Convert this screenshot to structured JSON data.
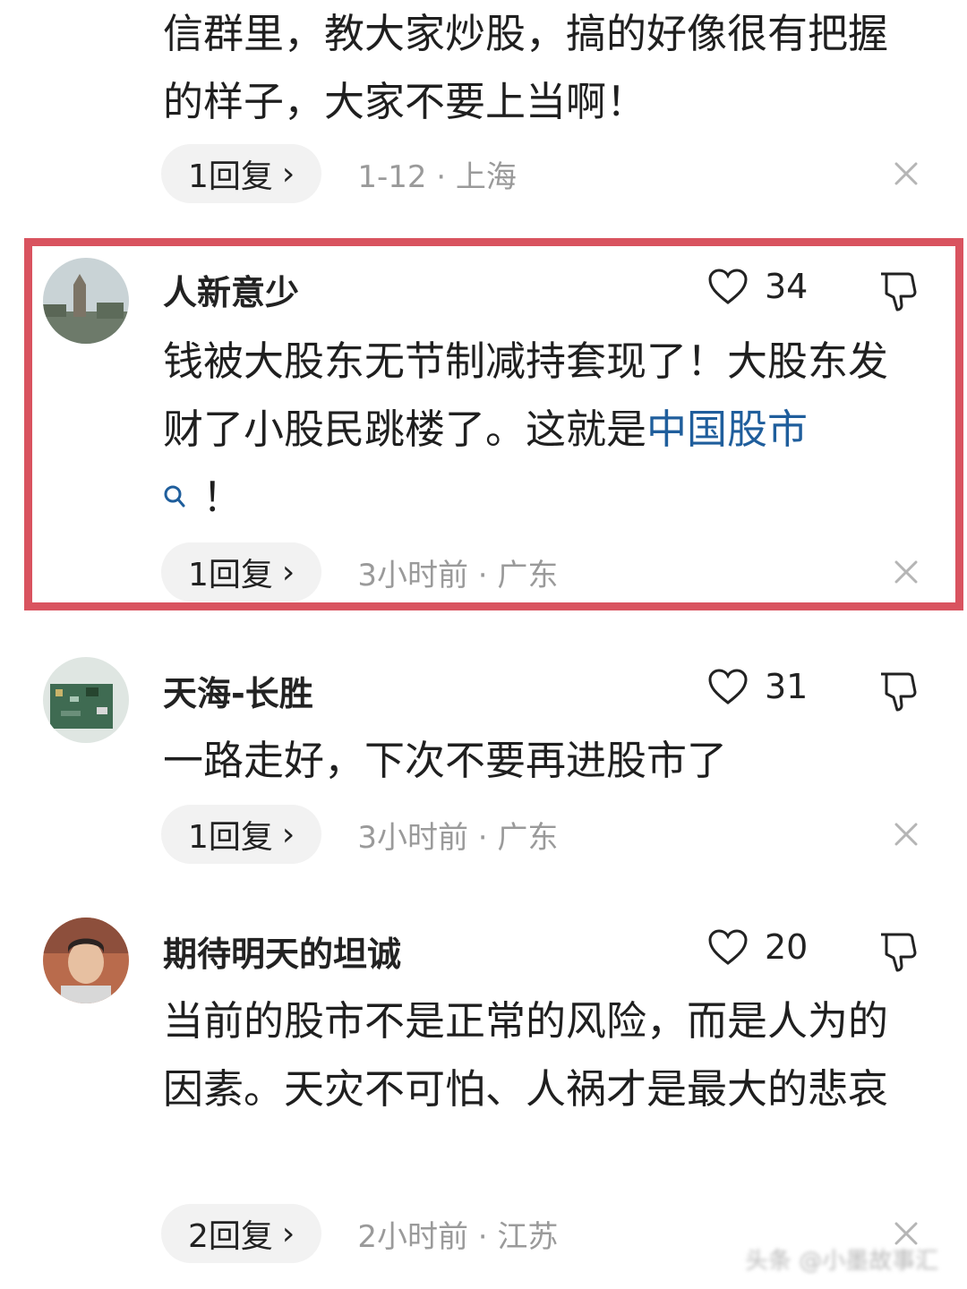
{
  "comments": [
    {
      "text_parts": [
        "信群里，教大家炒股，搞的好像很有把握的样子，大家不要上当啊！"
      ],
      "reply_label": "1回复",
      "time": "1-12",
      "location": "上海"
    },
    {
      "username": "人新意少",
      "likes": "34",
      "text_parts": [
        "钱被大股东无节制减持套现了！大股东发财了小股民跳楼了。这就是",
        "中国股市",
        "！"
      ],
      "reply_label": "1回复",
      "time": "3小时前",
      "location": "广东",
      "highlighted": true
    },
    {
      "username": "天海-长胜",
      "likes": "31",
      "text_parts": [
        "一路走好，下次不要再进股市了"
      ],
      "reply_label": "1回复",
      "time": "3小时前",
      "location": "广东"
    },
    {
      "username": "期待明天的坦诚",
      "likes": "20",
      "text_parts": [
        "当前的股市不是正常的风险，而是人为的因素。天灾不可怕、人祸才是最大的悲哀"
      ],
      "reply_label": "2回复",
      "time": "2小时前",
      "location": "江苏"
    }
  ],
  "separator": "·",
  "chevron": "›",
  "watermark": "头条 @小墨故事汇",
  "colors": {
    "highlight_border": "#d9535f",
    "link": "#1f5e9c",
    "meta": "#9a9a9a",
    "pill_bg": "#f2f2f2"
  },
  "icons": [
    "heart-icon",
    "thumbs-down-icon",
    "close-icon",
    "search-icon",
    "chevron-right-icon"
  ]
}
